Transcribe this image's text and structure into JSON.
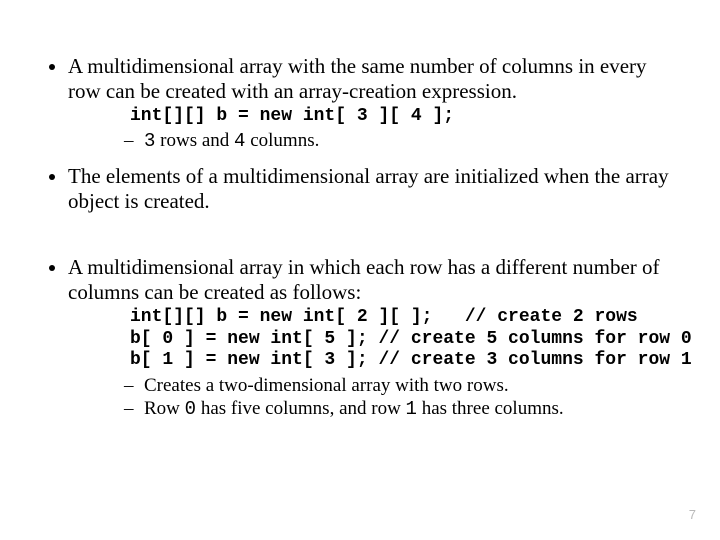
{
  "bullets": {
    "b1": {
      "text": "A multidimensional array with the same number of columns in every row can be created with an array-creation expression.",
      "code": "int[][] b = new int[ 3 ][ 4 ];",
      "sub1_pre": "",
      "sub1_m1": "3",
      "sub1_mid": " rows and ",
      "sub1_m2": "4",
      "sub1_post": " columns."
    },
    "b2": {
      "text": "The elements of a multidimensional array are initialized when the array object is created."
    },
    "b3": {
      "text": "A multidimensional array in which each row has a different number of columns can be created as follows:",
      "code": "int[][] b = new int[ 2 ][ ];   // create 2 rows\nb[ 0 ] = new int[ 5 ]; // create 5 columns for row 0\nb[ 1 ] = new int[ 3 ]; // create 3 columns for row 1",
      "sub1": "Creates a two-dimensional array with two rows.",
      "sub2_pre": "Row ",
      "sub2_m1": "0",
      "sub2_mid": " has five columns, and row ",
      "sub2_m2": "1",
      "sub2_post": " has three columns."
    }
  },
  "page_number": "7"
}
